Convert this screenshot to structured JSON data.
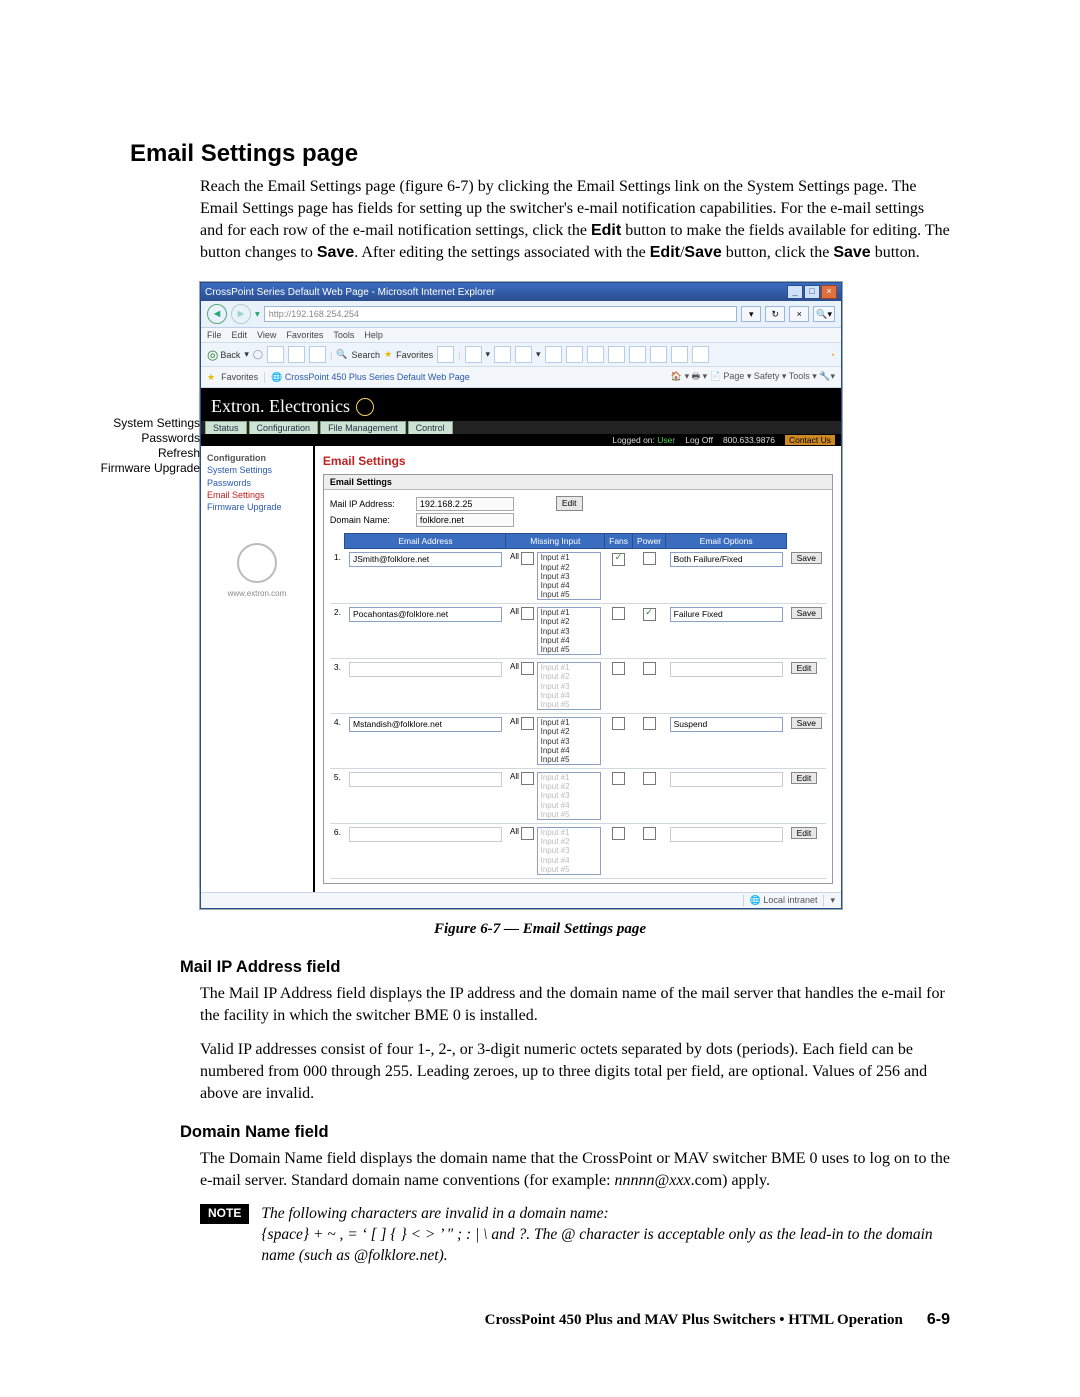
{
  "heading": "Email Settings page",
  "intro_html": "Reach the Email Settings page (figure 6-7) by clicking the Email Settings link on the System Settings page.  The Email Settings page has fields for setting up the switcher's e-mail notification capabilities.  For the e-mail settings and for each row of the e-mail notification settings, click the <b>Edit</b> button to make the fields available for editing.  The button changes to <b>Save</b>.  After editing the settings associated with the <b>Edit</b>/<b>Save</b> button, click the <b>Save</b> button.",
  "callouts": [
    "System Settings",
    "Passwords",
    "Refresh",
    "Firmware Upgrade"
  ],
  "browser": {
    "title": "CrossPoint Series Default Web Page - Microsoft Internet Explorer",
    "address": "http://192.168.254.254",
    "menu": [
      "File",
      "Edit",
      "View",
      "Favorites",
      "Tools",
      "Help"
    ],
    "toolbar": {
      "back": "Back",
      "search": "Search",
      "favorites": "Favorites"
    },
    "favbar_label": "Favorites",
    "fav_link": "CrossPoint 450 Plus Series Default Web Page",
    "fav_tools": "Page ▾   Safety ▾   Tools ▾",
    "brand": "Extron. Electronics",
    "tabs": [
      "Status",
      "Configuration",
      "File Management",
      "Control"
    ],
    "info": {
      "logged": "Logged on:",
      "user": "User",
      "logoff": "Log Off",
      "phone": "800.633.9876",
      "contact": "Contact Us"
    },
    "sidebar": {
      "group": "Configuration",
      "items": [
        "System Settings",
        "Passwords",
        "Email Settings",
        "Firmware Upgrade"
      ],
      "logo": "www.extron.com"
    },
    "panel": {
      "title": "Email Settings",
      "box_title": "Email Settings",
      "mail_ip_label": "Mail IP Address:",
      "mail_ip_value": "192.168.2.25",
      "domain_label": "Domain Name:",
      "domain_value": "folklore.net",
      "edit": "Edit",
      "save": "Save",
      "cols": [
        "Email Address",
        "Missing Input",
        "Fans",
        "Power",
        "Email Options"
      ],
      "inputs": [
        "Input #1",
        "Input #2",
        "Input #3",
        "Input #4",
        "Input #5"
      ],
      "all": "All",
      "rows": [
        {
          "n": "1.",
          "email": "JSmith@folklore.net",
          "fans": true,
          "power": false,
          "opt": "Both Failure/Fixed",
          "btn": "Save",
          "dim": false
        },
        {
          "n": "2.",
          "email": "Pocahontas@folklore.net",
          "fans": false,
          "power": true,
          "opt": "Failure Fixed",
          "btn": "Save",
          "dim": false
        },
        {
          "n": "3.",
          "email": "",
          "fans": false,
          "power": false,
          "opt": "",
          "btn": "Edit",
          "dim": true
        },
        {
          "n": "4.",
          "email": "Mstandish@folklore.net",
          "fans": false,
          "power": false,
          "opt": "Suspend",
          "btn": "Save",
          "dim": false
        },
        {
          "n": "5.",
          "email": "",
          "fans": false,
          "power": false,
          "opt": "",
          "btn": "Edit",
          "dim": true
        },
        {
          "n": "6.",
          "email": "",
          "fans": false,
          "power": false,
          "opt": "",
          "btn": "Edit",
          "dim": true
        }
      ]
    },
    "statusbar": "Local intranet"
  },
  "caption": "Figure 6-7 — Email Settings page",
  "sub1": {
    "title": "Mail IP Address field",
    "p1": "The Mail IP Address field displays the IP address and the domain name of the mail server that handles the e-mail for the facility in which the switcher BME 0 is installed.",
    "p2": "Valid IP addresses consist of four 1-, 2-, or 3-digit numeric octets separated by dots (periods).  Each field can be numbered from 000 through 255.  Leading zeroes, up to three digits total per field, are optional.  Values of 256 and above are invalid."
  },
  "sub2": {
    "title": "Domain Name field",
    "p1": "The Domain Name field displays the domain name that the CrossPoint or MAV switcher BME 0 uses to log on to the e-mail server.  Standard domain name conventions (for example: <i>nnnnn@xxx</i>.com) apply."
  },
  "note": {
    "label": "NOTE",
    "line1": "The following characters are invalid in a domain name:",
    "line2": "{space}  +   ~   ,   =   ‘   [   ]   {   }   <   >   ’   \"   ;   :   |   \\   and ?.   The @ character is acceptable only as the lead-in to the domain name (such as @folklore.net)."
  },
  "footer": {
    "title": "CrossPoint 450 Plus and MAV Plus Switchers • HTML Operation",
    "page": "6-9"
  }
}
